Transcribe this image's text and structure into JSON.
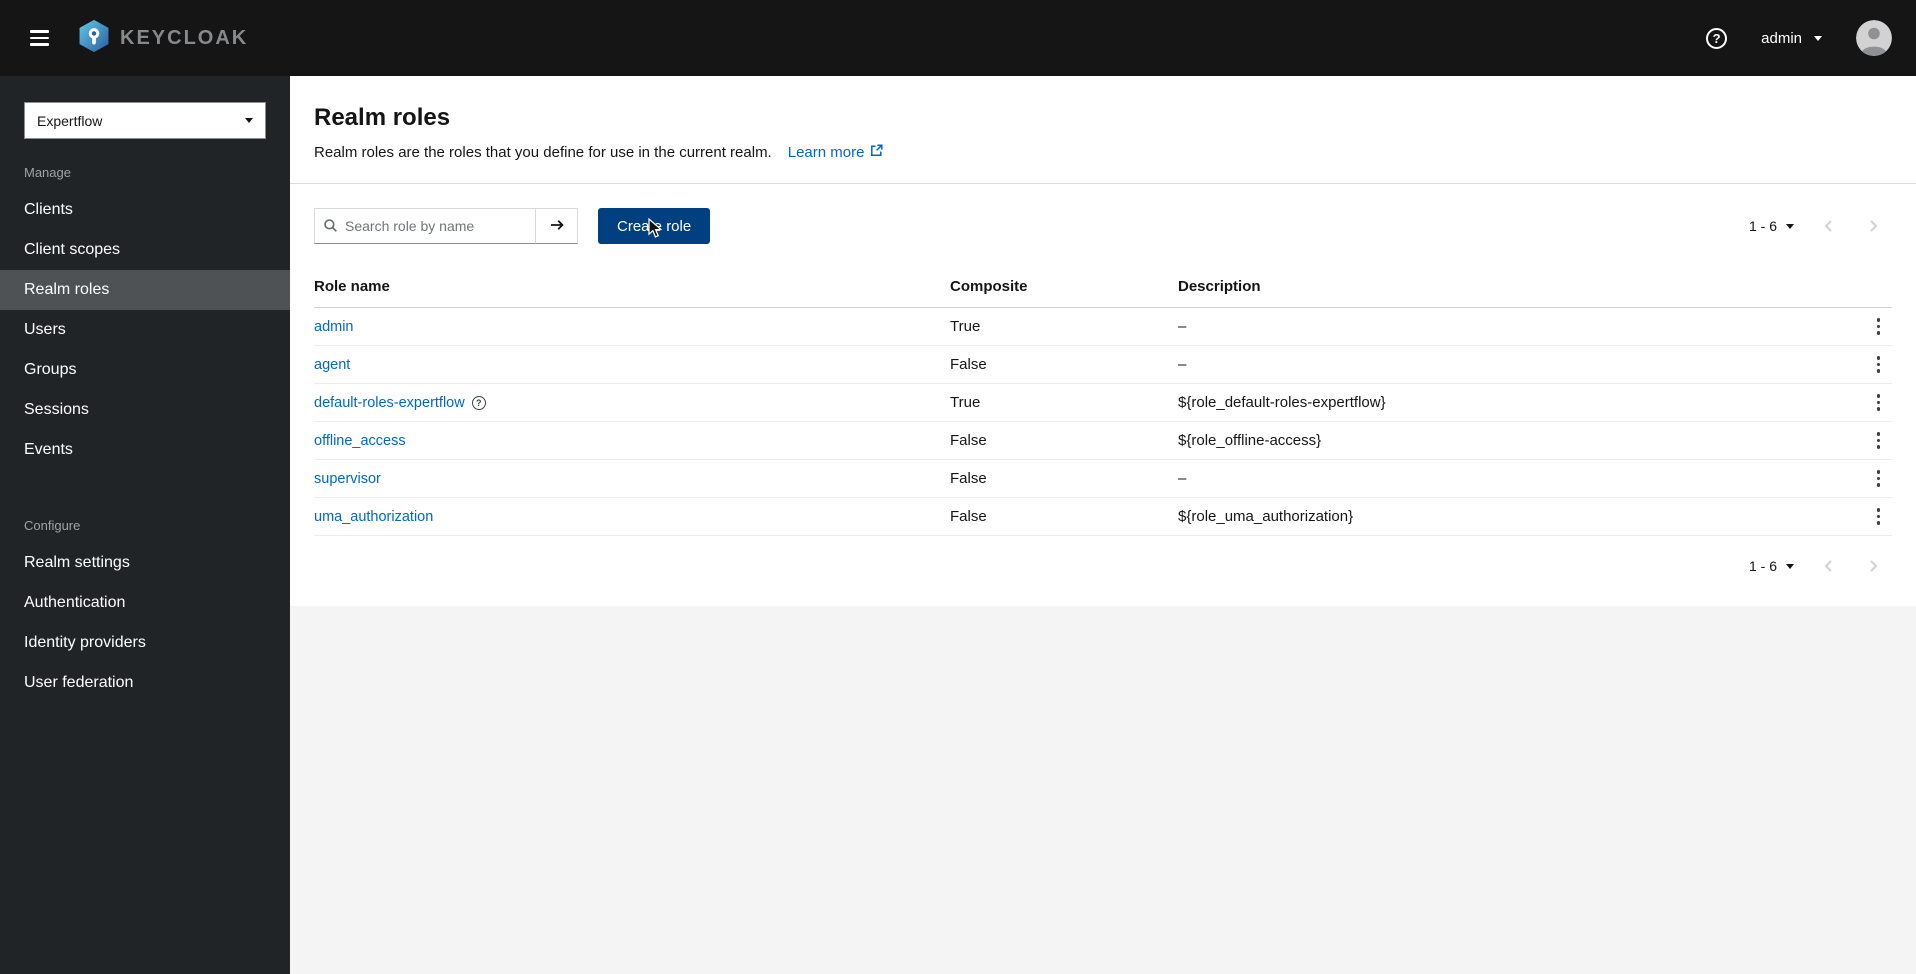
{
  "colors": {
    "masthead_bg": "#151515",
    "sidebar_bg": "#212427",
    "sidebar_selected_bg": "#4f5255",
    "link": "#0066cc",
    "primary_button_bg": "#004080"
  },
  "icons": {
    "nav_toggle": "hamburger-icon",
    "logo": "keycloak-logo-icon",
    "help": "question-circle-icon",
    "user_caret": "chevron-down-icon",
    "avatar": "user-avatar-icon",
    "realm_caret": "chevron-down-icon",
    "search": "search-icon",
    "search_submit": "arrow-right-icon",
    "learn_more": "external-link-icon",
    "pagination_prev": "chevron-left-icon",
    "pagination_next": "chevron-right-icon",
    "row_actions": "kebab-menu-icon",
    "role_help": "question-circle-icon",
    "pointer": "mouse-cursor"
  },
  "masthead": {
    "logo_text": "KEYCLOAK",
    "username": "admin"
  },
  "sidebar": {
    "realm_selector": {
      "value": "Expertflow"
    },
    "sections": [
      {
        "label": "Manage",
        "items": [
          {
            "label": "Clients",
            "current": false
          },
          {
            "label": "Client scopes",
            "current": false
          },
          {
            "label": "Realm roles",
            "current": true
          },
          {
            "label": "Users",
            "current": false
          },
          {
            "label": "Groups",
            "current": false
          },
          {
            "label": "Sessions",
            "current": false
          },
          {
            "label": "Events",
            "current": false
          }
        ]
      },
      {
        "label": "Configure",
        "items": [
          {
            "label": "Realm settings",
            "current": false
          },
          {
            "label": "Authentication",
            "current": false
          },
          {
            "label": "Identity providers",
            "current": false
          },
          {
            "label": "User federation",
            "current": false
          }
        ]
      }
    ]
  },
  "page": {
    "title": "Realm roles",
    "subtitle": "Realm roles are the roles that you define for use in the current realm.",
    "learn_more_label": "Learn more"
  },
  "toolbar": {
    "search_placeholder": "Search role by name",
    "create_button_label": "Create role",
    "pagination_range": "1 - 6"
  },
  "table": {
    "columns": [
      "Role name",
      "Composite",
      "Description"
    ],
    "rows": [
      {
        "name": "admin",
        "composite": "True",
        "description": "–",
        "help_icon": false
      },
      {
        "name": "agent",
        "composite": "False",
        "description": "–",
        "help_icon": false
      },
      {
        "name": "default-roles-expertflow",
        "composite": "True",
        "description": "${role_default-roles-expertflow}",
        "help_icon": true
      },
      {
        "name": "offline_access",
        "composite": "False",
        "description": "${role_offline-access}",
        "help_icon": false
      },
      {
        "name": "supervisor",
        "composite": "False",
        "description": "–",
        "help_icon": false
      },
      {
        "name": "uma_authorization",
        "composite": "False",
        "description": "${role_uma_authorization}",
        "help_icon": false
      }
    ]
  }
}
